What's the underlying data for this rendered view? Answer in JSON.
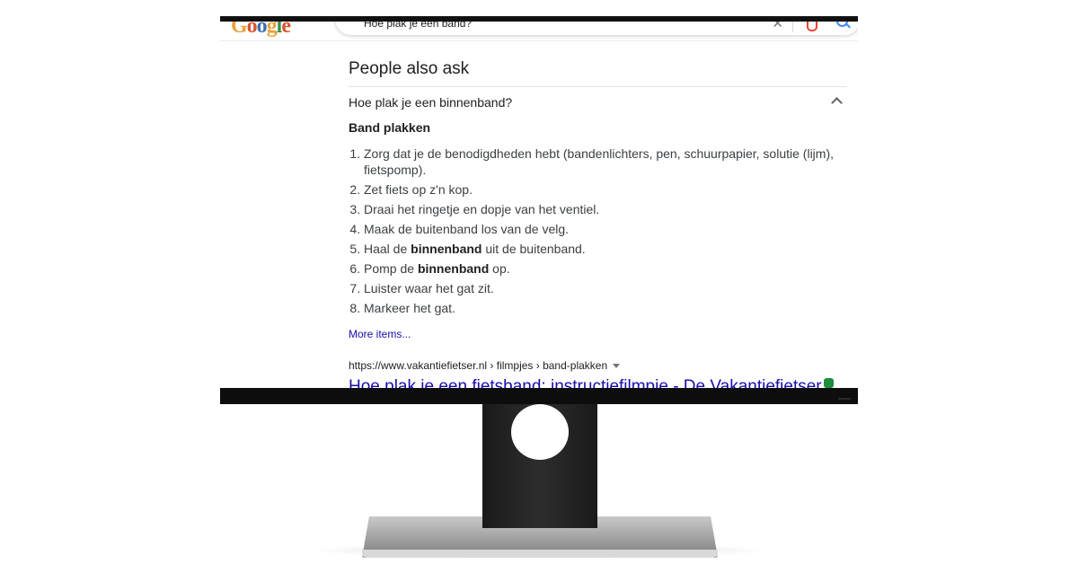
{
  "search": {
    "query": "Hoe plak je een band?",
    "logo_text": "Google"
  },
  "people_also_ask": {
    "title": "People also ask",
    "question": "Hoe plak je een binnenband?",
    "answer_title": "Band plakken",
    "steps": [
      {
        "before": "Zorg dat je de benodigdheden hebt (bandenlichters, pen, schuurpapier, solutie (lijm), fietspomp).",
        "bold": "",
        "after": ""
      },
      {
        "before": "Zet fiets op z'n kop.",
        "bold": "",
        "after": ""
      },
      {
        "before": "Draai het ringetje en dopje van het ventiel.",
        "bold": "",
        "after": ""
      },
      {
        "before": "Maak de buitenband los van de velg.",
        "bold": "",
        "after": ""
      },
      {
        "before": "Haal de ",
        "bold": "binnenband",
        "after": " uit de buitenband."
      },
      {
        "before": "Pomp de ",
        "bold": "binnenband",
        "after": " op."
      },
      {
        "before": "Luister waar het gat zit.",
        "bold": "",
        "after": ""
      },
      {
        "before": "Markeer het gat.",
        "bold": "",
        "after": ""
      }
    ],
    "more_items": "More items...",
    "source_cite": "https://www.vakantiefietser.nl › filmpjes › band-plakken",
    "result_title": "Hoe plak je een fietsband: instructiefilmpje - De Vakantiefietser"
  },
  "icons": {
    "clear": "close-icon",
    "mic": "microphone-icon",
    "search": "search-icon",
    "expand": "chevron-up-icon",
    "verified": "verified-badge-icon"
  },
  "colors": {
    "link": "#1a0dab",
    "text": "#202124",
    "verified": "#1e8e3e"
  }
}
